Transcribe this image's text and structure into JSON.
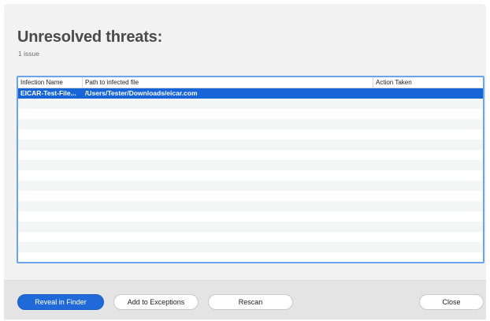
{
  "header": {
    "title": "Unresolved threats:",
    "subtitle": "1 issue"
  },
  "table": {
    "columns": [
      "Infection Name",
      "Path to infected file",
      "Action Taken"
    ],
    "rows": [
      {
        "name": "EICAR-Test-File...",
        "path": "/Users/Tester/Downloads/eicar.com",
        "action": "",
        "selected": true
      }
    ]
  },
  "buttons": {
    "reveal": "Reveal in Finder",
    "add_exceptions": "Add to Exceptions",
    "rescan": "Rescan",
    "close": "Close"
  },
  "colors": {
    "accent": "#1f6ad8",
    "selection": "#1764d6",
    "table_border": "#6aa3f0"
  }
}
